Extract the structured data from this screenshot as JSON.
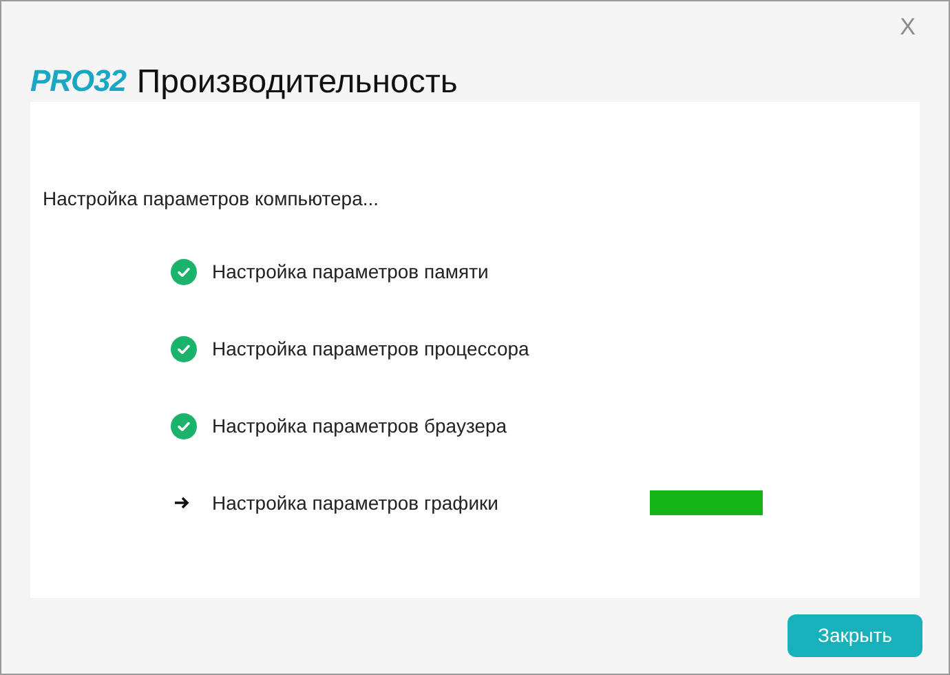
{
  "window": {
    "close": "X"
  },
  "header": {
    "logo": "PRO32",
    "title": "Производительность"
  },
  "message": "Настройка параметров компьютера...",
  "steps": [
    {
      "label": "Настройка параметров памяти",
      "kind": "done"
    },
    {
      "label": "Настройка параметров процессора",
      "kind": "done"
    },
    {
      "label": "Настройка параметров браузера",
      "kind": "done"
    },
    {
      "label": "Настройка параметров графики",
      "kind": "active"
    }
  ],
  "buttons": [
    "Закрыть"
  ]
}
